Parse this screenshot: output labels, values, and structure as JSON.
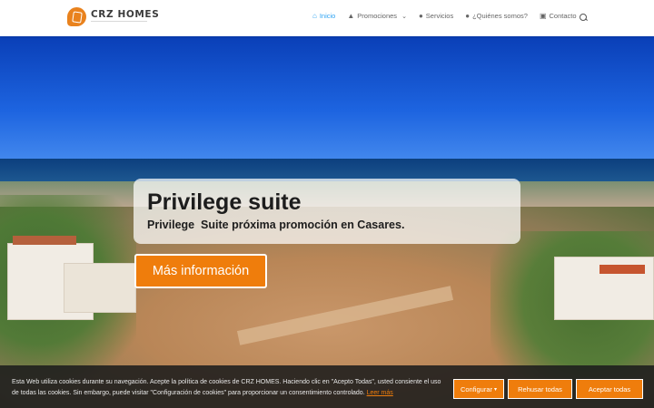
{
  "header": {
    "logo_text": "CRZ HOMES",
    "nav": [
      {
        "label": "Inicio",
        "icon": "home-icon",
        "active": true
      },
      {
        "label": "Promociones",
        "icon": "buildings-icon",
        "has_dropdown": true
      },
      {
        "label": "Servicios",
        "icon": "info-icon"
      },
      {
        "label": "¿Quiénes somos?",
        "icon": "users-icon"
      },
      {
        "label": "Contacto",
        "icon": "contact-card-icon"
      }
    ],
    "search_icon": "search-icon"
  },
  "hero": {
    "title": "Privilege suite",
    "subtitle": "Privilege  Suite próxima promoción en Casares.",
    "button_label": "Más información"
  },
  "cookie_bar": {
    "text": "Esta Web utiliza cookies durante su navegación. Acepte la política de cookies de CRZ HOMES. Haciendo clic en \"Acepto Todas\", usted consiente el uso de todas las cookies. Sin embargo, puede visitar \"Configuración de cookies\" para proporcionar un consentimiento controlado.",
    "link_label": "Leer más",
    "configure_label": "Configurar",
    "reject_label": "Rehusar todas",
    "accept_label": "Aceptar todas"
  },
  "colors": {
    "accent": "#ef7d0c",
    "nav_active": "#2ea3f2",
    "cookie_bg": "#1c1c1c"
  }
}
